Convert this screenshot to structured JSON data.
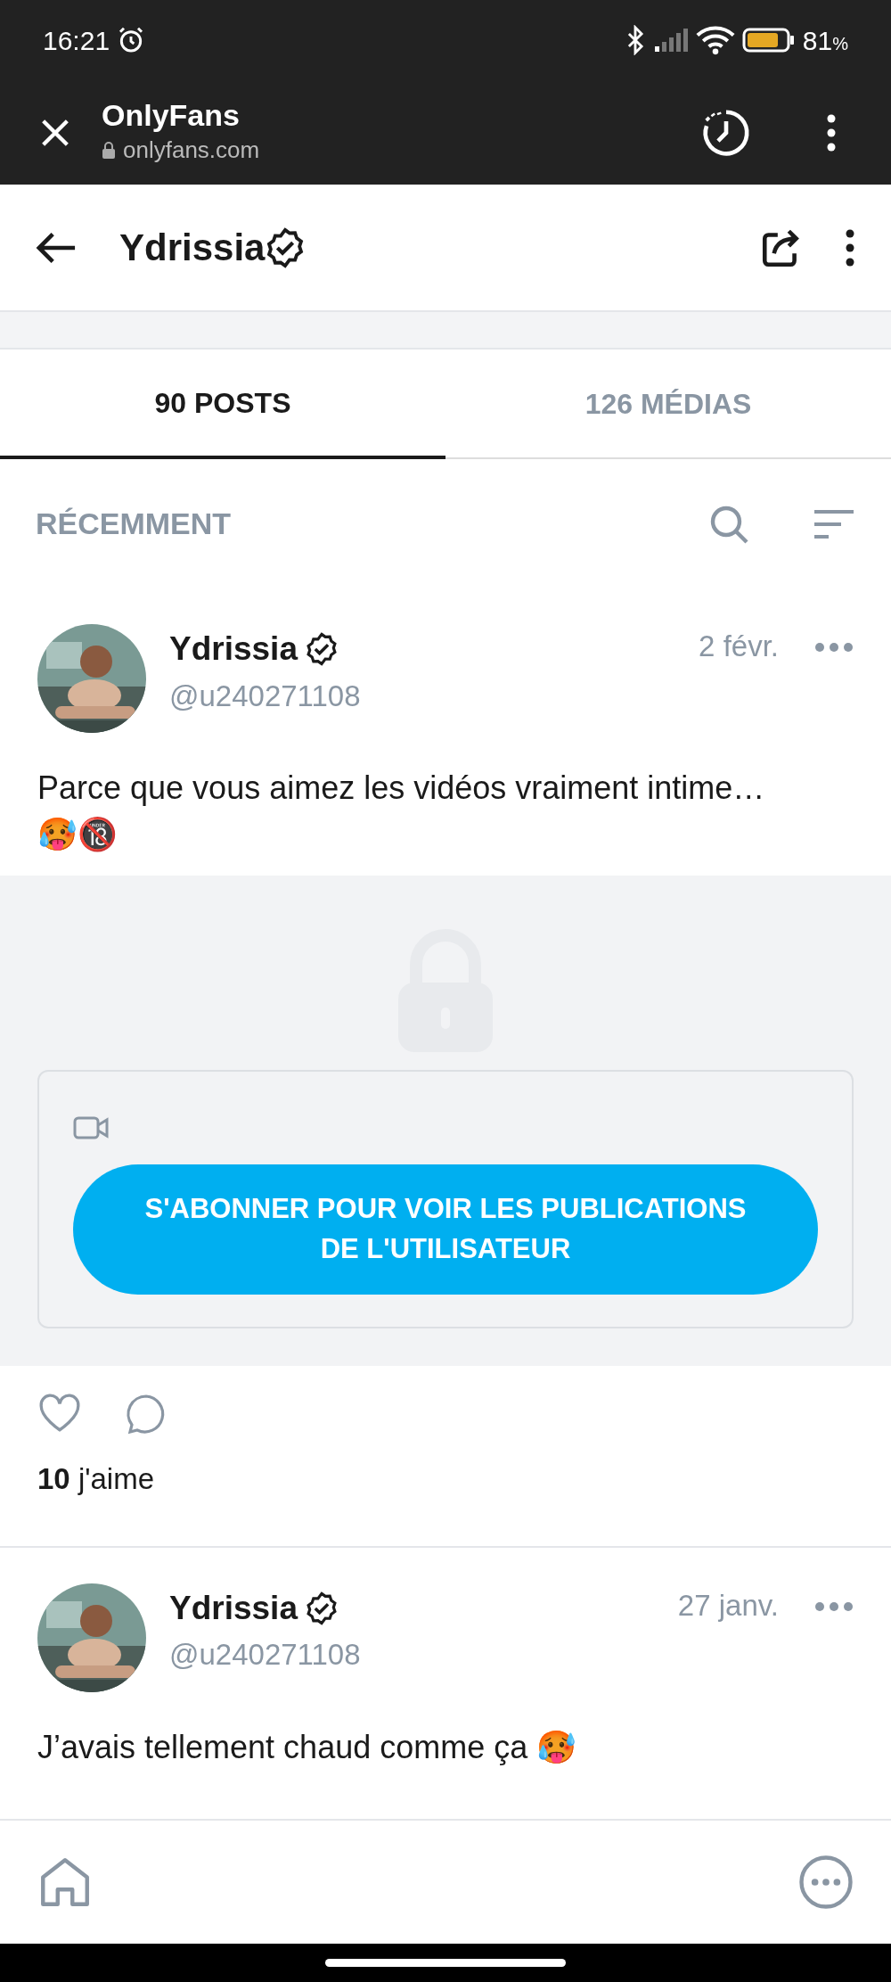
{
  "status_bar": {
    "time": "16:21",
    "battery": "81",
    "battery_unit": "%"
  },
  "browser": {
    "title": "OnlyFans",
    "url": "onlyfans.com"
  },
  "header": {
    "title": "Ydrissia",
    "verified": true
  },
  "tabs": [
    {
      "label": "90 POSTS",
      "selected": true
    },
    {
      "label": "126 MÉDIAS",
      "selected": false
    }
  ],
  "filter": {
    "label": "RÉCEMMENT"
  },
  "posts": [
    {
      "name": "Ydrissia",
      "verified": true,
      "handle": "@u240271108",
      "date": "2 févr.",
      "text": "Parce que vous aimez les vidéos vraiment intime…",
      "emojis": "🥵🔞",
      "locked": true,
      "subscribe_button": "S'ABONNER POUR VOIR LES PUBLICATIONS DE L'UTILISATEUR",
      "likes": "**10** j'aime"
    },
    {
      "name": "Ydrissia",
      "verified": true,
      "handle": "@u240271108",
      "date": "27 janv.",
      "text": "J’avais tellement chaud comme ça 🥵",
      "locked": false
    }
  ]
}
